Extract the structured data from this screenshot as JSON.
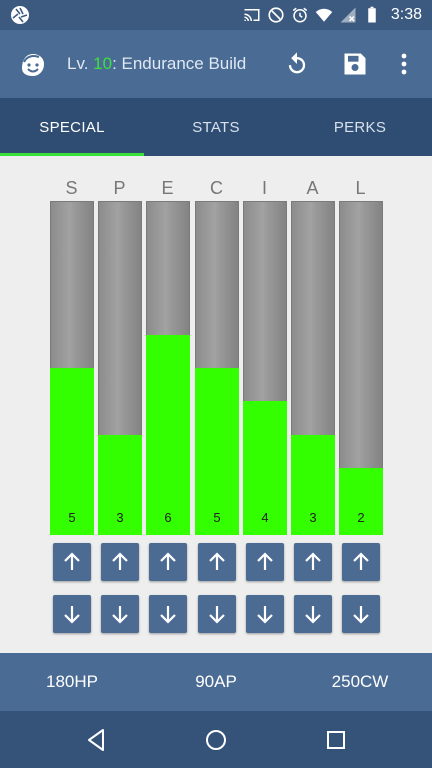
{
  "status_bar": {
    "time": "3:38",
    "icons": [
      "shutter-icon",
      "cast-icon",
      "do-not-disturb-icon",
      "alarm-icon",
      "wifi-icon",
      "no-signal-icon",
      "battery-icon"
    ]
  },
  "app_bar": {
    "level_prefix": "Lv. ",
    "level": "10",
    "build_title": ": Endurance Build",
    "icons": [
      "vault-boy-face-icon",
      "refresh-icon",
      "save-icon",
      "more-vert-icon"
    ]
  },
  "tabs": [
    {
      "label": "SPECIAL",
      "active": true
    },
    {
      "label": "STATS",
      "active": false
    },
    {
      "label": "PERKS",
      "active": false
    }
  ],
  "special": {
    "max_value": 10,
    "attributes": [
      {
        "letter": "S",
        "value": 5
      },
      {
        "letter": "P",
        "value": 3
      },
      {
        "letter": "E",
        "value": 6
      },
      {
        "letter": "C",
        "value": 5
      },
      {
        "letter": "I",
        "value": 4
      },
      {
        "letter": "A",
        "value": 3
      },
      {
        "letter": "L",
        "value": 2
      }
    ]
  },
  "footer": {
    "hp": "180HP",
    "ap": "90AP",
    "cw": "250CW"
  },
  "nav_bar": {
    "icons": [
      "back-icon",
      "home-icon",
      "recents-icon"
    ]
  },
  "colors": {
    "fill": "#33ff00",
    "accent_green": "#39e039",
    "app_bar": "#4a6b93",
    "tabs": "#2f4d73"
  }
}
